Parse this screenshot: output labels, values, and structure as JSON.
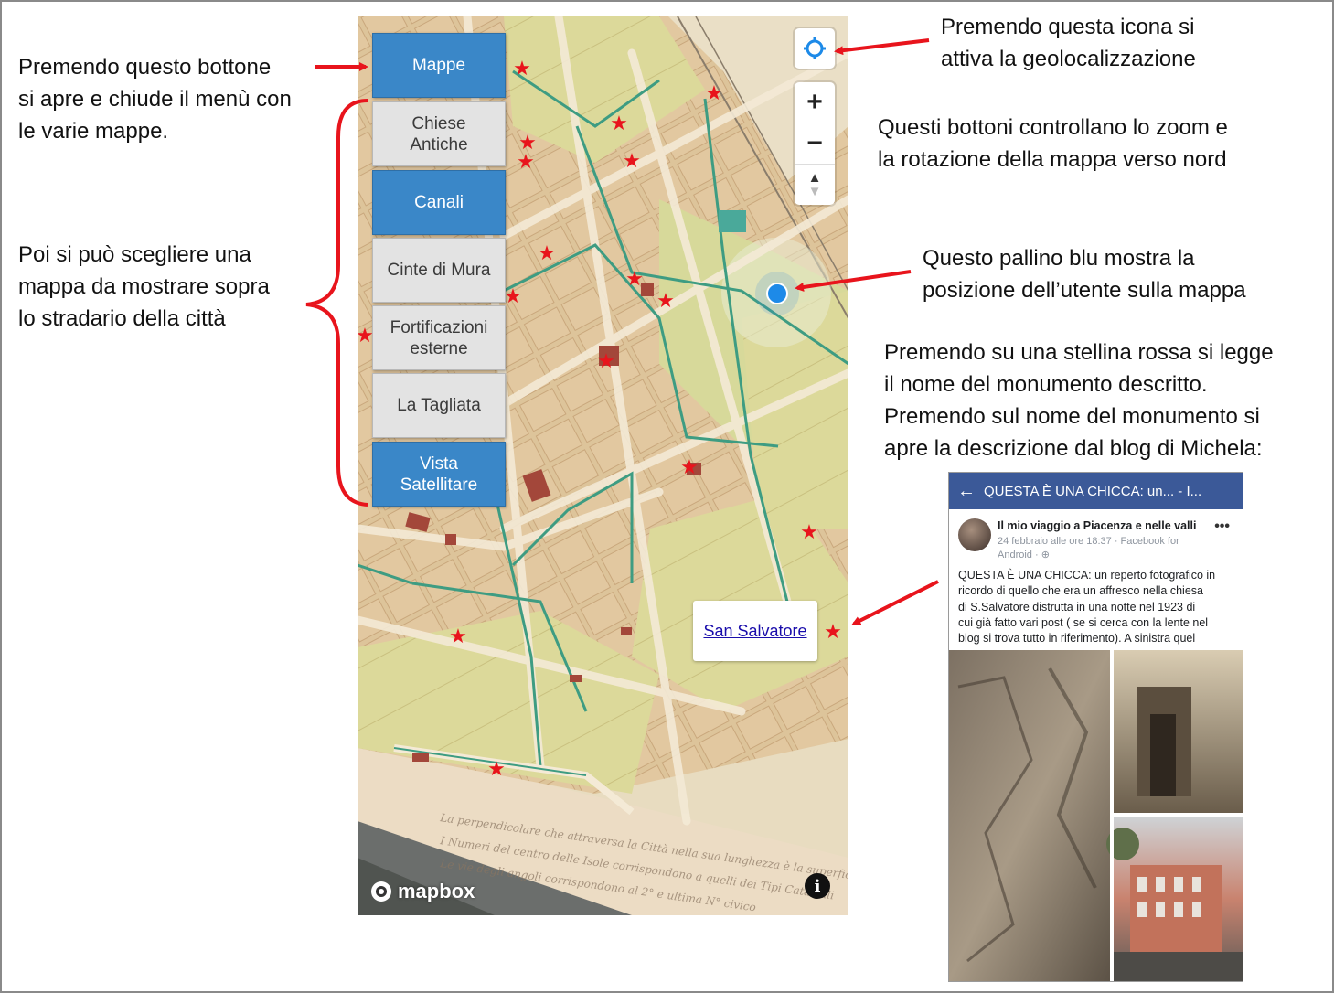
{
  "annotations": {
    "menu_toggle": [
      "Premendo questo bottone",
      "si apre e chiude il menù con",
      "le varie mappe."
    ],
    "choose_map": [
      "Poi si può scegliere una",
      "mappa da mostrare sopra",
      "lo stradario della città"
    ],
    "geolocation": [
      "Premendo questa icona si",
      "attiva la geolocalizzazione"
    ],
    "zoom": [
      "Questi bottoni controllano lo zoom e",
      "la rotazione della mappa verso nord"
    ],
    "user_dot": [
      "Questo pallino blu mostra la",
      "posizione dell’utente sulla mappa"
    ],
    "star": [
      "Premendo su una stellina rossa si legge",
      "il nome del monumento descritto.",
      "Premendo sul nome del monumento si",
      "apre la descrizione dal blog di Michela:"
    ]
  },
  "map_menu": {
    "toggle": "Mappe",
    "items": [
      "Chiese\nAntiche",
      "Canali",
      "Cinte di Mura",
      "Fortificazioni\nesterne",
      "La Tagliata",
      "Vista\nSatellitare"
    ]
  },
  "map_controls": {
    "zoom_in": "+",
    "zoom_out": "−",
    "compass": "▲"
  },
  "popup": {
    "link": "San Salvatore"
  },
  "attribution": {
    "logo": "mapbox",
    "info": "i"
  },
  "facebook": {
    "title": "QUESTA È UNA CHICCA: un... - I...",
    "back": "←",
    "author": "Il mio viaggio a Piacenza e nelle valli",
    "meta": "24 febbraio alle ore 18:37 · Facebook for Android · ⊕",
    "more": "•••",
    "text_lines": [
      "QUESTA È UNA CHICCA: un reperto fotografico in",
      "ricordo di quello che era un affresco nella chiesa",
      "di S.Salvatore distrutta in una notte nel 1923 di",
      "cui già fatto vari post ( se si cerca con la lente nel",
      "blog si trova tutto in riferimento). A sinistra quel"
    ]
  },
  "colors": {
    "arrow": "#e8141c",
    "menu_blue": "#3a87c8",
    "menu_grey": "#e3e3e3",
    "fb_blue": "#3b5998",
    "star": "#e8141c"
  }
}
